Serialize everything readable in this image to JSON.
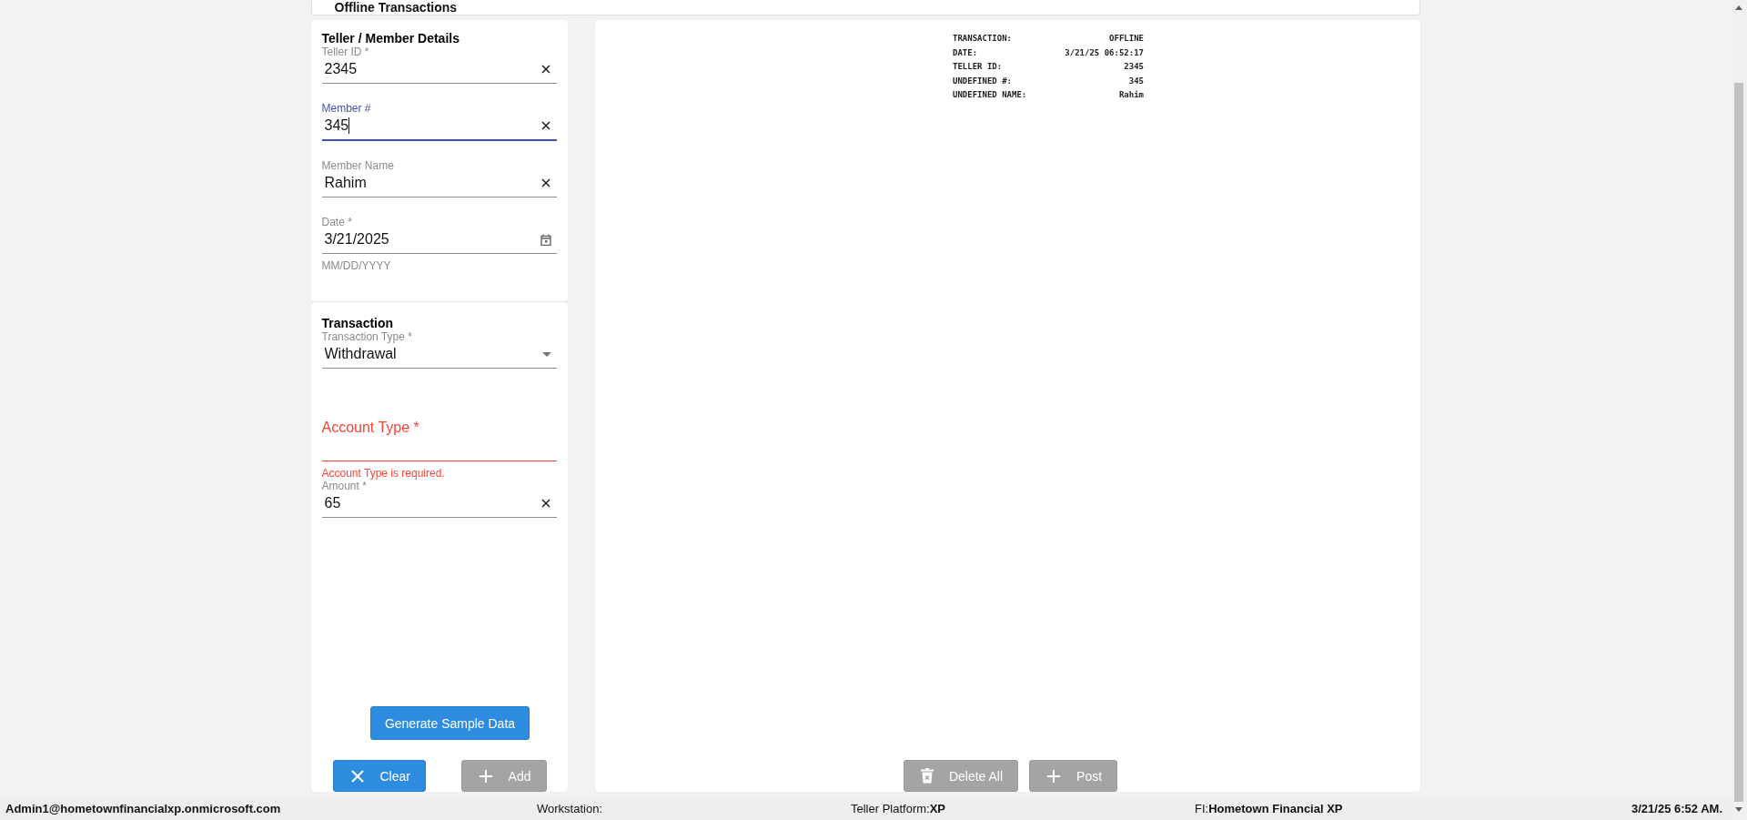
{
  "header": {
    "title": "Offline Transactions"
  },
  "teller_details": {
    "title": "Teller / Member Details",
    "fields": [
      {
        "kind": "text",
        "label": "Teller ID *",
        "value": "2345",
        "focused": false
      },
      {
        "kind": "text",
        "label": "Member #",
        "value": "345",
        "focused": true
      },
      {
        "kind": "text",
        "label": "Member Name",
        "value": "Rahim",
        "focused": false
      },
      {
        "kind": "date",
        "label": "Date *",
        "value": "3/21/2025",
        "hint": "MM/DD/YYYY",
        "focused": false
      }
    ]
  },
  "transaction": {
    "title": "Transaction",
    "fields": [
      {
        "kind": "select",
        "label": "Transaction Type *",
        "value": "Withdrawal",
        "focused": false
      },
      {
        "kind": "select_empty",
        "label": "Account Type *",
        "error": "Account Type is required.",
        "focused": false
      },
      {
        "kind": "text",
        "label": "Amount *",
        "value": "65",
        "focused": false
      }
    ],
    "buttons": [
      {
        "kind": "primary",
        "label": "Generate Sample Data"
      }
    ],
    "actions": [
      {
        "kind": "clear",
        "label": "Clear",
        "disabled": false
      },
      {
        "kind": "add",
        "label": "Add",
        "disabled": true
      }
    ]
  },
  "receipt": {
    "rows": [
      {
        "label": "TRANSACTION:",
        "value": "OFFLINE"
      },
      {
        "label": "DATE:",
        "value": "3/21/25 06:52:17"
      },
      {
        "label": "TELLER ID:",
        "value": "2345"
      },
      {
        "label": "UNDEFINED #:",
        "value": "345"
      },
      {
        "label": "UNDEFINED NAME:",
        "value": "Rahim"
      }
    ],
    "actions": [
      {
        "kind": "delete",
        "label": "Delete All",
        "disabled": true
      },
      {
        "kind": "add",
        "label": "Post",
        "disabled": true
      }
    ]
  },
  "status_bar": {
    "user": "Admin1@hometownfinancialxp.onmicrosoft.com",
    "workstation_label": "Workstation:",
    "platform_label": "Teller Platform:",
    "platform_value": "XP",
    "fi_label": "FI:",
    "fi_value": "Hometown Financial XP",
    "datetime": "3/21/25 6:52 AM."
  }
}
